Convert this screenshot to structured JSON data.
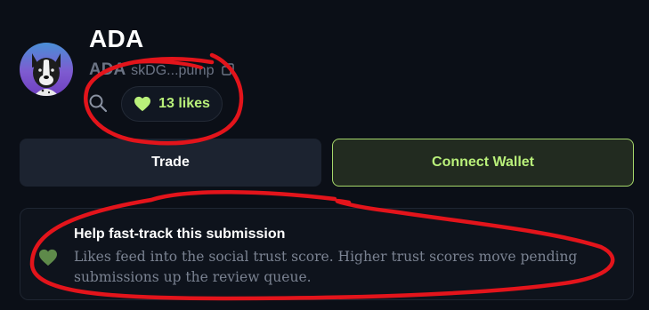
{
  "token": {
    "name": "ADA",
    "ticker": "ADA",
    "address": "skDG...pump"
  },
  "likes": {
    "label": "13 likes"
  },
  "actions": {
    "trade_label": "Trade",
    "connect_label": "Connect Wallet"
  },
  "info": {
    "title": "Help fast-track this submission",
    "body": "Likes feed into the social trust score. Higher trust scores move pending submissions up the review queue."
  },
  "icons": {
    "copy": "copy-icon",
    "search": "search-icon",
    "heart": "heart-icon"
  },
  "colors": {
    "background": "#0b0f17",
    "accent_green": "#b9f07a",
    "muted_green_heart": "#5e8a4a",
    "annotation_red": "#e3141b"
  }
}
